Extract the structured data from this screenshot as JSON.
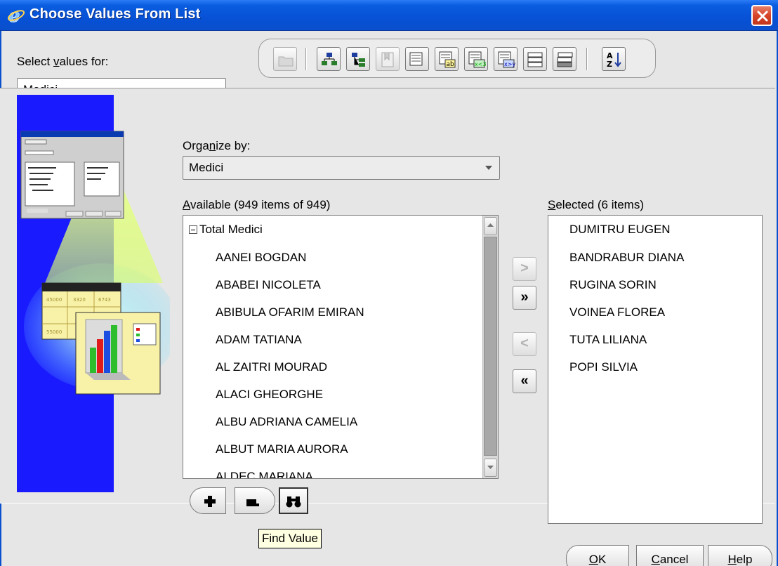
{
  "window": {
    "title": "Choose Values From List"
  },
  "select_values": {
    "label_pre": "Select ",
    "label_key": "v",
    "label_post": "alues for:",
    "value": "Medici"
  },
  "organize": {
    "label_pre": "Orga",
    "label_key": "n",
    "label_post": "ize by:",
    "value": "Medici"
  },
  "available": {
    "label_key": "A",
    "label_post": "vailable (949 items of 949)",
    "root": "Total Medici",
    "items": [
      "AANEI BOGDAN",
      "ABABEI NICOLETA",
      "ABIBULA OFARIM EMIRAN",
      "ADAM TATIANA",
      "AL ZAITRI MOURAD",
      "ALACI GHEORGHE",
      "ALBU ADRIANA CAMELIA",
      "ALBUT  MARIA AURORA",
      "ALDEC MARIANA"
    ]
  },
  "selected": {
    "label_key": "S",
    "label_post": "elected (6 items)",
    "items": [
      "DUMITRU EUGEN",
      "BANDRABUR DIANA",
      "RUGINA SORIN",
      "VOINEA FLOREA",
      "TUTA LILIANA",
      "POPI SILVIA"
    ]
  },
  "move_buttons": {
    "add_one": ">",
    "add_all": "»",
    "remove_one": "<",
    "remove_all": "«"
  },
  "tooltip": "Find Value",
  "buttons": {
    "ok_key": "O",
    "ok_post": "K",
    "cancel_key": "C",
    "cancel_post": "ancel",
    "help_key": "H",
    "help_post": "elp"
  },
  "colors": {
    "titlebar": "#0751d6",
    "illustration_bg": "#1a1aff"
  }
}
